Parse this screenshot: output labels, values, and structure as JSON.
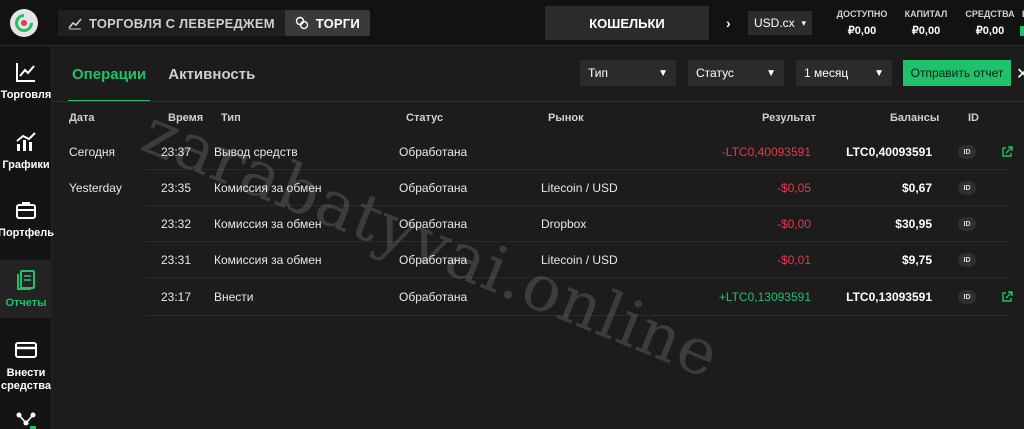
{
  "topbar": {
    "mode_leverage": "ТОРГОВЛЯ С ЛЕВЕРЕДЖЕМ",
    "mode_trades": "ТОРГИ",
    "wallets": "КОШЕЛЬКИ",
    "currency": "USD.cx",
    "stats": [
      {
        "label": "ДОСТУПНО",
        "value": "₽0,00"
      },
      {
        "label": "КАПИТАЛ",
        "value": "₽0,00"
      },
      {
        "label": "СРЕДСТВА",
        "value": "₽0,00"
      },
      {
        "label": "Е",
        "value": ""
      }
    ]
  },
  "sidebar": {
    "items": [
      {
        "label": "Торговля",
        "icon": "trending-chart-icon"
      },
      {
        "label": "Графики",
        "icon": "bar-line-chart-icon"
      },
      {
        "label": "Портфель",
        "icon": "briefcase-icon"
      },
      {
        "label": "Отчеты",
        "icon": "report-document-icon"
      },
      {
        "label": "Внести",
        "label2": "средства",
        "icon": "card-icon"
      },
      {
        "label": "",
        "icon": "network-icon"
      }
    ]
  },
  "tabs": [
    "Операции",
    "Активность"
  ],
  "filters": {
    "type": "Тип",
    "status": "Статус",
    "period": "1 месяц",
    "send_report": "Отправить отчет"
  },
  "table": {
    "headers": {
      "date": "Дата",
      "time": "Время",
      "type": "Тип",
      "status": "Статус",
      "market": "Рынок",
      "result": "Результат",
      "balances": "Балансы",
      "id": "ID"
    },
    "rows": [
      {
        "date": "Сегодня",
        "time": "23:37",
        "type": "Вывод средств",
        "status": "Обработана",
        "market": "",
        "result": "-LTC0,40093591",
        "result_sign": "neg",
        "balance": "LTC0,40093591",
        "id": "ID",
        "link": true
      },
      {
        "date": "Yesterday",
        "time": "23:35",
        "type": "Комиссия за обмен",
        "status": "Обработана",
        "market": "Litecoin / USD",
        "result": "-$0,05",
        "result_sign": "neg",
        "balance": "$0,67",
        "id": "ID",
        "link": false
      },
      {
        "date": "",
        "time": "23:32",
        "type": "Комиссия за обмен",
        "status": "Обработана",
        "market": "Dropbox",
        "result": "-$0,00",
        "result_sign": "neg",
        "balance": "$30,95",
        "id": "ID",
        "link": false
      },
      {
        "date": "",
        "time": "23:31",
        "type": "Комиссия за обмен",
        "status": "Обработана",
        "market": "Litecoin / USD",
        "result": "-$0,01",
        "result_sign": "neg",
        "balance": "$9,75",
        "id": "ID",
        "link": false
      },
      {
        "date": "",
        "time": "23:17",
        "type": "Внести",
        "status": "Обработана",
        "market": "",
        "result": "+LTC0,13093591",
        "result_sign": "pos",
        "balance": "LTC0,13093591",
        "id": "ID",
        "link": true
      }
    ]
  },
  "watermark": "zarabatyvai.online",
  "colors": {
    "accent": "#1ec26b",
    "negative": "#e03a4e",
    "background": "#1c1c1c"
  }
}
